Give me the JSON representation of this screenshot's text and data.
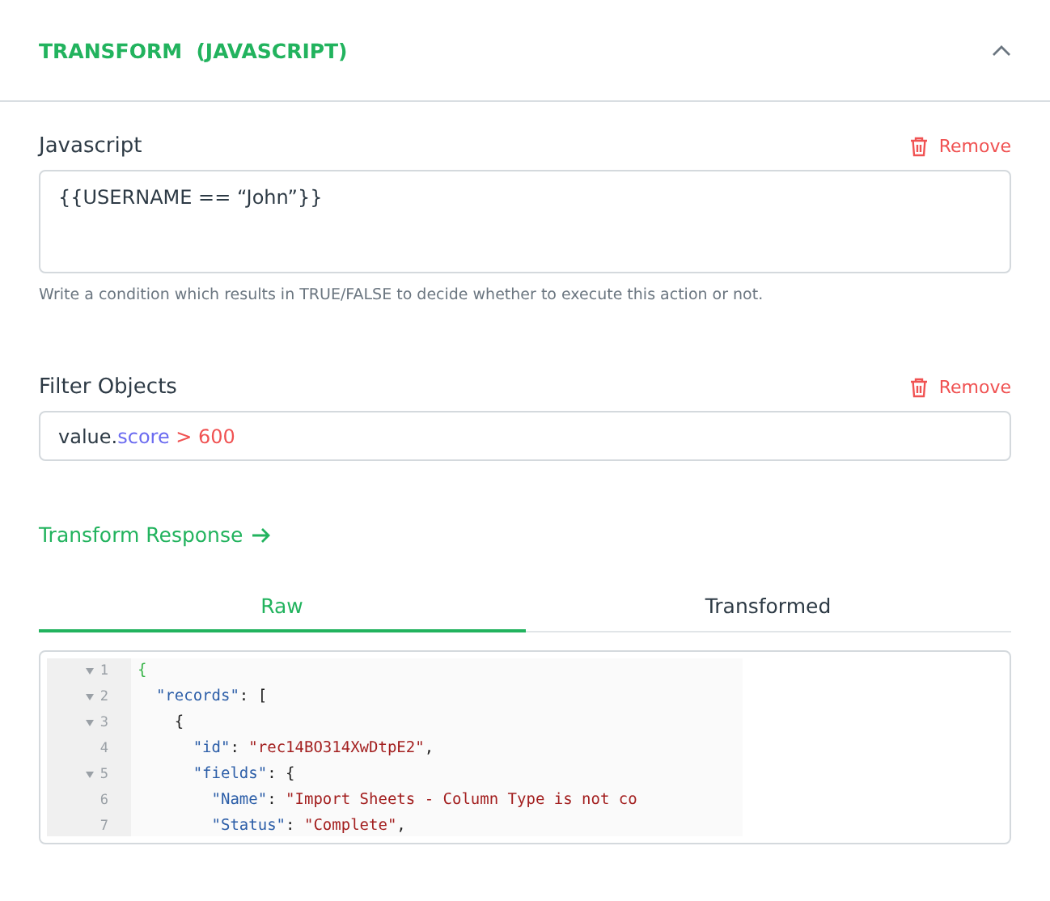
{
  "header": {
    "title": "TRANSFORM  (JAVASCRIPT)",
    "expanded": true
  },
  "javascript": {
    "label": "Javascript",
    "remove": "Remove",
    "value": "{{USERNAME == “John”}}",
    "hint": "Write a condition which results in TRUE/FALSE to decide whether to execute this action or not."
  },
  "filter": {
    "label": "Filter Objects",
    "remove": "Remove",
    "tokens": [
      {
        "kind": "plain",
        "text": "value."
      },
      {
        "kind": "property",
        "text": "score"
      },
      {
        "kind": "operator",
        "text": " > 600"
      }
    ]
  },
  "transform_link": "Transform Response",
  "tabs": [
    {
      "label": "Raw",
      "selected": true
    },
    {
      "label": "Transformed",
      "selected": false
    }
  ],
  "code": [
    {
      "number": "1",
      "foldable": true,
      "tokens": [
        {
          "kind": "brace",
          "text": "{"
        }
      ]
    },
    {
      "number": "2",
      "foldable": true,
      "tokens": [
        {
          "kind": "key",
          "text": "  \"records\""
        },
        {
          "kind": "punct",
          "text": ": ["
        }
      ]
    },
    {
      "number": "3",
      "foldable": true,
      "tokens": [
        {
          "kind": "punct",
          "text": "    {"
        }
      ]
    },
    {
      "number": "4",
      "foldable": false,
      "tokens": [
        {
          "kind": "key",
          "text": "      \"id\""
        },
        {
          "kind": "punct",
          "text": ": "
        },
        {
          "kind": "string",
          "text": "\"rec14BO314XwDtpE2\""
        },
        {
          "kind": "punct",
          "text": ","
        }
      ]
    },
    {
      "number": "5",
      "foldable": true,
      "tokens": [
        {
          "kind": "key",
          "text": "      \"fields\""
        },
        {
          "kind": "punct",
          "text": ": {"
        }
      ]
    },
    {
      "number": "6",
      "foldable": false,
      "tokens": [
        {
          "kind": "key",
          "text": "        \"Name\""
        },
        {
          "kind": "punct",
          "text": ": "
        },
        {
          "kind": "string",
          "text": "\"Import Sheets - Column Type is not co"
        }
      ]
    },
    {
      "number": "7",
      "foldable": false,
      "tokens": [
        {
          "kind": "key",
          "text": "        \"Status\""
        },
        {
          "kind": "punct",
          "text": ": "
        },
        {
          "kind": "string",
          "text": "\"Complete\""
        },
        {
          "kind": "punct",
          "text": ","
        }
      ]
    }
  ]
}
